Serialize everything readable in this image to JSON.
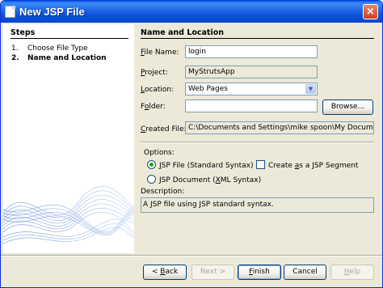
{
  "window": {
    "title": "New JSP File",
    "close_glyph": "×"
  },
  "steps": {
    "title": "Steps",
    "items": [
      {
        "num": "1.",
        "label": "Choose File Type"
      },
      {
        "num": "2.",
        "label": "Name and Location"
      }
    ]
  },
  "main": {
    "title": "Name and Location",
    "file_name": {
      "label_u": "F",
      "label_rest": "ile Name:",
      "value": "login"
    },
    "project": {
      "label_u": "P",
      "label_rest": "roject:",
      "value": "MyStrutsApp"
    },
    "location": {
      "label_u": "L",
      "label_rest": "ocation:",
      "value": "Web Pages"
    },
    "folder": {
      "label_pre": "F",
      "label_u": "o",
      "label_rest": "lder:",
      "value": ""
    },
    "browse_button": "Browse...",
    "created_file": {
      "label_u": "C",
      "label_rest": "reated File:",
      "value": "C:\\Documents and Settings\\mike spoon\\My Documents\\Net"
    },
    "options": {
      "label": "Options:",
      "jsp_file": {
        "pre": "",
        "u": "J",
        "rest": "SP File (Standard Syntax)",
        "selected": true
      },
      "jsp_document": {
        "pre": "JSP Document (",
        "u": "X",
        "rest": "ML Syntax)",
        "selected": false
      },
      "segment": {
        "pre": "Create ",
        "u": "a",
        "rest": "s a JSP Segment",
        "checked": false
      }
    },
    "description": {
      "label": "Description:",
      "text": "A JSP file using JSP standard syntax."
    }
  },
  "buttons": {
    "back": {
      "pre": "< ",
      "u": "B",
      "rest": "ack"
    },
    "next": "Next >",
    "finish": {
      "u": "F",
      "rest": "inish"
    },
    "cancel": "Cancel",
    "help": {
      "u": "H",
      "rest": "elp"
    }
  },
  "colors": {
    "title_bar": "#0a4fd8",
    "dialog_bg": "#ece9d8",
    "radio_dot": "#21a121"
  }
}
